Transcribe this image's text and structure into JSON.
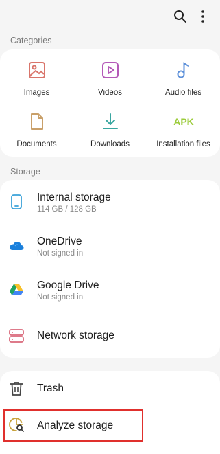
{
  "header": {
    "search_icon": "search-icon",
    "more_icon": "more-vert-icon"
  },
  "categories": {
    "label": "Categories",
    "items": [
      {
        "label": "Images",
        "icon": "image-icon",
        "color": "#d9756b"
      },
      {
        "label": "Videos",
        "icon": "video-icon",
        "color": "#b45ab8"
      },
      {
        "label": "Audio files",
        "icon": "audio-icon",
        "color": "#5b8fd9"
      },
      {
        "label": "Documents",
        "icon": "document-icon",
        "color": "#c9a06a"
      },
      {
        "label": "Downloads",
        "icon": "download-icon",
        "color": "#39a6a0"
      },
      {
        "label": "Installation files",
        "icon": "apk-icon",
        "text": "APK",
        "color": "#9ccc3c"
      }
    ]
  },
  "storage": {
    "label": "Storage",
    "items": [
      {
        "title": "Internal storage",
        "subtitle": "114 GB / 128 GB",
        "icon": "phone-icon"
      },
      {
        "title": "OneDrive",
        "subtitle": "Not signed in",
        "icon": "onedrive-icon"
      },
      {
        "title": "Google Drive",
        "subtitle": "Not signed in",
        "icon": "google-drive-icon"
      },
      {
        "title": "Network storage",
        "subtitle": "",
        "icon": "network-storage-icon"
      }
    ]
  },
  "tools": {
    "items": [
      {
        "title": "Trash",
        "icon": "trash-icon"
      },
      {
        "title": "Analyze storage",
        "icon": "analyze-storage-icon"
      }
    ]
  },
  "colors": {
    "highlight": "#e0302d",
    "background": "#f5f5f5",
    "card": "#ffffff"
  }
}
